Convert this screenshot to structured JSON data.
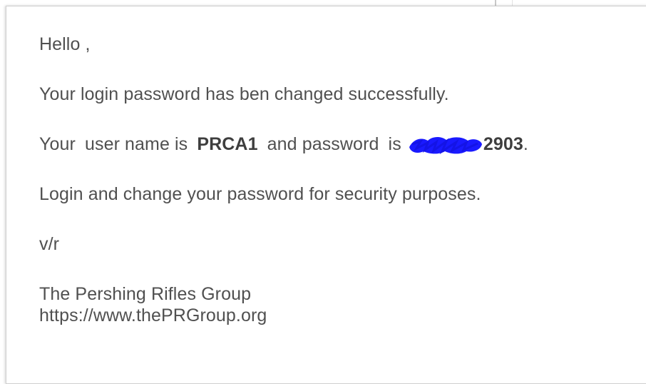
{
  "email": {
    "greeting": "Hello ,",
    "line_changed": "Your login password has ben changed successfully.",
    "credentials": {
      "prefix_your": "Your",
      "prefix_username_is": "user name is",
      "username": "PRCA1",
      "and_password": "and password",
      "is": "is",
      "password_visible_suffix": "2903",
      "period": "."
    },
    "line_security": "Login and change your password for security purposes.",
    "closing": "v/r",
    "signature": {
      "org_name": "The Pershing Rifles Group",
      "url": "https://www.thePRGroup.org"
    }
  },
  "colors": {
    "text": "#505050",
    "text_bold": "#3e3e3e",
    "redaction": "#1a1aff",
    "panel_border": "#cfcfcf"
  },
  "icons": {
    "redaction_mark": "blue-scribble-redaction"
  }
}
